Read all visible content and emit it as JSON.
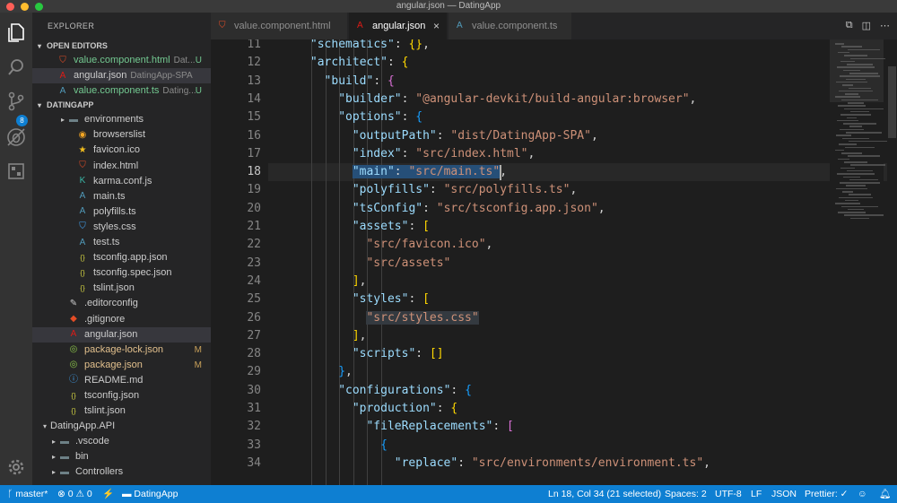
{
  "window": {
    "title": "angular.json — DatingApp"
  },
  "activity_bar": {
    "scm_badge": "8",
    "icons": [
      "files-icon",
      "search-icon",
      "source-control-icon",
      "debug-icon",
      "extensions-icon",
      "gear-icon"
    ]
  },
  "explorer": {
    "header": "EXPLORER",
    "open_editors_title": "OPEN EDITORS",
    "open_editors": [
      {
        "name": "value.component.html",
        "desc": "Dat...",
        "status": "U",
        "icon": "html-icon"
      },
      {
        "name": "angular.json",
        "desc": "DatingApp-SPA",
        "status": "",
        "icon": "angular-icon"
      },
      {
        "name": "value.component.ts",
        "desc": "Dating...",
        "status": "U",
        "icon": "ts-icon"
      }
    ],
    "workspace_title": "DATINGAPP",
    "tree": [
      {
        "name": "environments",
        "icon": "folder-icon",
        "twisty": "▸"
      },
      {
        "name": "browserslist",
        "icon": "browserslist-icon"
      },
      {
        "name": "favicon.ico",
        "icon": "star-icon"
      },
      {
        "name": "index.html",
        "icon": "html-icon"
      },
      {
        "name": "karma.conf.js",
        "icon": "karma-icon"
      },
      {
        "name": "main.ts",
        "icon": "ts-icon"
      },
      {
        "name": "polyfills.ts",
        "icon": "ts-icon"
      },
      {
        "name": "styles.css",
        "icon": "css-icon"
      },
      {
        "name": "test.ts",
        "icon": "ts-icon"
      },
      {
        "name": "tsconfig.app.json",
        "icon": "json-icon"
      },
      {
        "name": "tsconfig.spec.json",
        "icon": "json-icon"
      },
      {
        "name": "tslint.json",
        "icon": "json-icon"
      },
      {
        "name": ".editorconfig",
        "icon": "editorconfig-icon"
      },
      {
        "name": ".gitignore",
        "icon": "git-icon"
      },
      {
        "name": "angular.json",
        "icon": "angular-icon"
      },
      {
        "name": "package-lock.json",
        "icon": "npm-icon",
        "status": "M"
      },
      {
        "name": "package.json",
        "icon": "npm-icon",
        "status": "M"
      },
      {
        "name": "README.md",
        "icon": "info-icon"
      },
      {
        "name": "tsconfig.json",
        "icon": "json-icon"
      },
      {
        "name": "tslint.json",
        "icon": "json-icon"
      },
      {
        "name": "DatingApp.API",
        "icon": "",
        "twisty": "▾"
      },
      {
        "name": ".vscode",
        "icon": "folder-icon",
        "twisty": "▸"
      },
      {
        "name": "bin",
        "icon": "folder-icon",
        "twisty": "▸"
      },
      {
        "name": "Controllers",
        "icon": "folder-icon",
        "twisty": "▸"
      }
    ]
  },
  "tabs": [
    {
      "label": "value.component.html",
      "icon": "html-icon",
      "active": false
    },
    {
      "label": "angular.json",
      "icon": "angular-icon",
      "active": true,
      "close": "×"
    },
    {
      "label": "value.component.ts",
      "icon": "ts-icon",
      "active": false
    }
  ],
  "editor": {
    "line_numbers": [
      "11",
      "12",
      "13",
      "14",
      "15",
      "16",
      "17",
      "18",
      "19",
      "20",
      "21",
      "22",
      "23",
      "24",
      "25",
      "26",
      "27",
      "28",
      "29",
      "30",
      "31",
      "32",
      "33",
      "34"
    ],
    "current_line": "18",
    "top_partial": "\"prefix\": \"app\",",
    "lines": [
      {
        "indent": 3,
        "tokens": [
          [
            "k",
            "\"schematics\""
          ],
          [
            "p",
            ": "
          ],
          [
            "b1",
            "{}"
          ],
          [
            "p",
            ","
          ]
        ]
      },
      {
        "indent": 3,
        "tokens": [
          [
            "k",
            "\"architect\""
          ],
          [
            "p",
            ": "
          ],
          [
            "b1",
            "{"
          ]
        ]
      },
      {
        "indent": 4,
        "tokens": [
          [
            "k",
            "\"build\""
          ],
          [
            "p",
            ": "
          ],
          [
            "b2",
            "{"
          ]
        ]
      },
      {
        "indent": 5,
        "tokens": [
          [
            "k",
            "\"builder\""
          ],
          [
            "p",
            ": "
          ],
          [
            "s",
            "\"@angular-devkit/build-angular:browser\""
          ],
          [
            "p",
            ","
          ]
        ]
      },
      {
        "indent": 5,
        "tokens": [
          [
            "k",
            "\"options\""
          ],
          [
            "p",
            ": "
          ],
          [
            "b3",
            "{"
          ]
        ]
      },
      {
        "indent": 6,
        "tokens": [
          [
            "k",
            "\"outputPath\""
          ],
          [
            "p",
            ": "
          ],
          [
            "s",
            "\"dist/DatingApp-SPA\""
          ],
          [
            "p",
            ","
          ]
        ]
      },
      {
        "indent": 6,
        "tokens": [
          [
            "k",
            "\"index\""
          ],
          [
            "p",
            ": "
          ],
          [
            "s",
            "\"src/index.html\""
          ],
          [
            "p",
            ","
          ]
        ]
      },
      {
        "indent": 6,
        "tokens": [
          [
            "k sel",
            "\"main\""
          ],
          [
            "p sel",
            ": "
          ],
          [
            "s sel",
            "\"src/main.ts\""
          ],
          [
            "p",
            ","
          ]
        ]
      },
      {
        "indent": 6,
        "tokens": [
          [
            "k",
            "\"polyfills\""
          ],
          [
            "p",
            ": "
          ],
          [
            "s",
            "\"src/polyfills.ts\""
          ],
          [
            "p",
            ","
          ]
        ]
      },
      {
        "indent": 6,
        "tokens": [
          [
            "k",
            "\"tsConfig\""
          ],
          [
            "p",
            ": "
          ],
          [
            "s",
            "\"src/tsconfig.app.json\""
          ],
          [
            "p",
            ","
          ]
        ]
      },
      {
        "indent": 6,
        "tokens": [
          [
            "k",
            "\"assets\""
          ],
          [
            "p",
            ": "
          ],
          [
            "b1",
            "["
          ]
        ]
      },
      {
        "indent": 7,
        "tokens": [
          [
            "s",
            "\"src/favicon.ico\""
          ],
          [
            "p",
            ","
          ]
        ]
      },
      {
        "indent": 7,
        "tokens": [
          [
            "s",
            "\"src/assets\""
          ]
        ]
      },
      {
        "indent": 6,
        "tokens": [
          [
            "b1",
            "]"
          ],
          [
            "p",
            ","
          ]
        ]
      },
      {
        "indent": 6,
        "tokens": [
          [
            "k",
            "\"styles\""
          ],
          [
            "p",
            ": "
          ],
          [
            "b1",
            "["
          ]
        ]
      },
      {
        "indent": 7,
        "tokens": [
          [
            "s hl",
            "\"src/styles.css\""
          ]
        ]
      },
      {
        "indent": 6,
        "tokens": [
          [
            "b1",
            "]"
          ],
          [
            "p",
            ","
          ]
        ]
      },
      {
        "indent": 6,
        "tokens": [
          [
            "k",
            "\"scripts\""
          ],
          [
            "p",
            ": "
          ],
          [
            "b1",
            "[]"
          ]
        ]
      },
      {
        "indent": 5,
        "tokens": [
          [
            "b3",
            "}"
          ],
          [
            "p",
            ","
          ]
        ]
      },
      {
        "indent": 5,
        "tokens": [
          [
            "k",
            "\"configurations\""
          ],
          [
            "p",
            ": "
          ],
          [
            "b3",
            "{"
          ]
        ]
      },
      {
        "indent": 6,
        "tokens": [
          [
            "k",
            "\"production\""
          ],
          [
            "p",
            ": "
          ],
          [
            "b1",
            "{"
          ]
        ]
      },
      {
        "indent": 7,
        "tokens": [
          [
            "k",
            "\"fileReplacements\""
          ],
          [
            "p",
            ": "
          ],
          [
            "b2",
            "["
          ]
        ]
      },
      {
        "indent": 8,
        "tokens": [
          [
            "b3",
            "{"
          ]
        ]
      },
      {
        "indent": 9,
        "tokens": [
          [
            "k",
            "\"replace\""
          ],
          [
            "p",
            ": "
          ],
          [
            "s",
            "\"src/environments/environment.ts\""
          ],
          [
            "p",
            ","
          ]
        ]
      }
    ]
  },
  "statusbar": {
    "branch": "master*",
    "errors": "0",
    "warnings": "0",
    "folder": "DatingApp",
    "position": "Ln 18, Col 34 (21 selected)",
    "spaces": "Spaces: 2",
    "encoding": "UTF-8",
    "eol": "LF",
    "language": "JSON",
    "prettier": "Prettier: ✓"
  },
  "colors": {
    "accent": "#0e7fd2",
    "key": "#9cdcfe",
    "string": "#ce9178",
    "modified": "#e2c08d",
    "untracked": "#73c991"
  }
}
